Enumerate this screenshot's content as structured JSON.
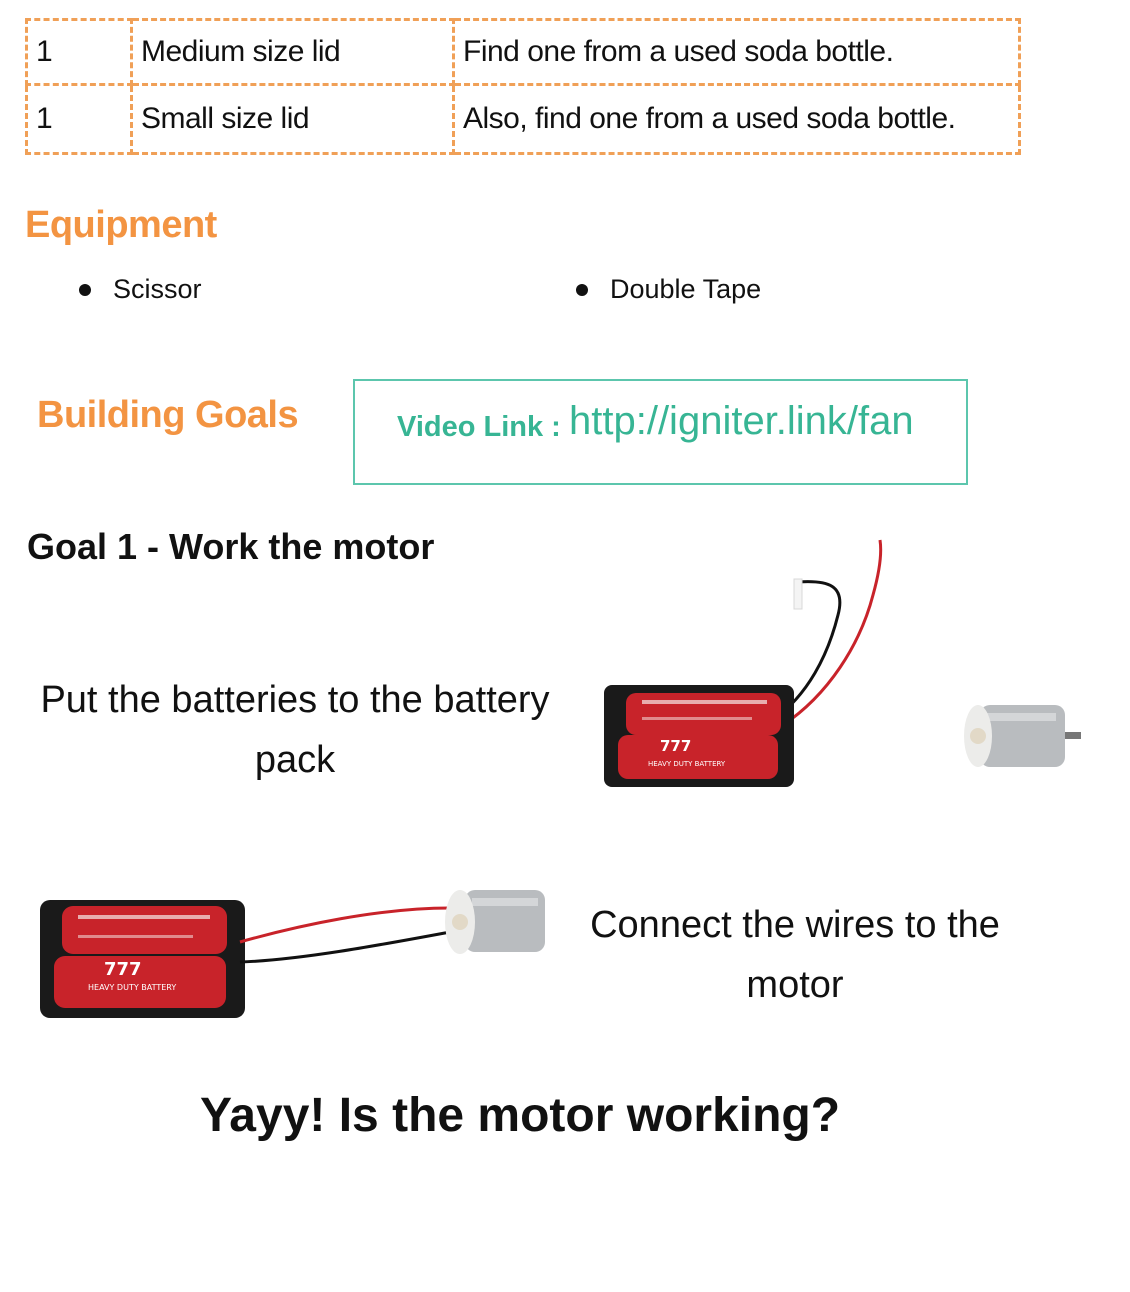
{
  "materials": {
    "rows": [
      {
        "qty": "1",
        "item": "Medium size lid",
        "note": "Find one from a used soda bottle."
      },
      {
        "qty": "1",
        "item": "Small size lid",
        "note": "Also, find one from a used soda bottle."
      }
    ]
  },
  "equipment": {
    "heading": "Equipment",
    "items": [
      "Scissor",
      "Double Tape"
    ]
  },
  "building_goals": {
    "heading": "Building Goals",
    "video_label": "Video Link :",
    "video_url": "http://igniter.link/fan"
  },
  "goal1": {
    "title": "Goal 1 - Work the motor",
    "step1_text": "Put the batteries to the battery pack",
    "step2_text": "Connect the wires to the motor",
    "final_question": "Yayy! Is the motor working?"
  },
  "battery_labels": {
    "brand": "777",
    "type": "HEAVY DUTY BATTERY"
  },
  "colors": {
    "accent_orange": "#f39442",
    "table_border": "#f0a057",
    "link_teal": "#37b594",
    "battery_red": "#c8232a",
    "holder_black": "#1a1a1a",
    "motor_silver": "#b9bcbf"
  }
}
